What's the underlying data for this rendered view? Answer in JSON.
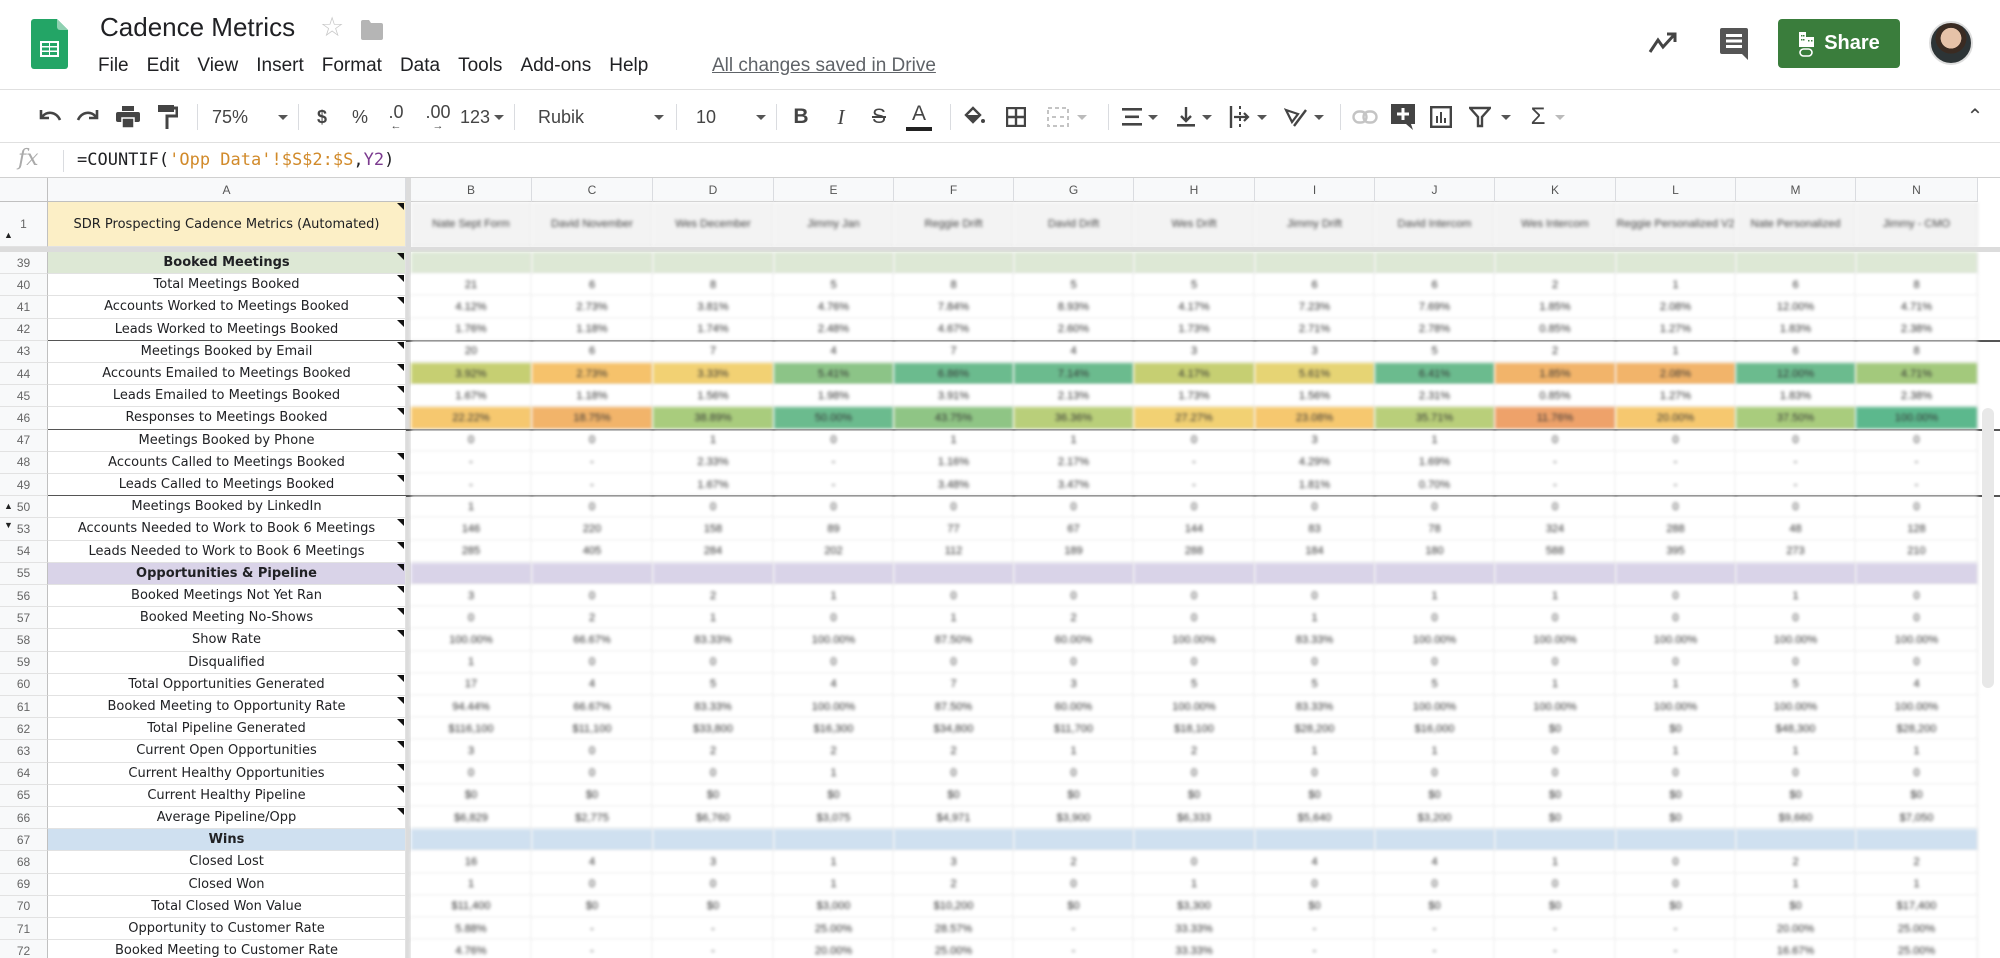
{
  "app": {
    "doc_title": "Cadence Metrics",
    "menu": [
      "File",
      "Edit",
      "View",
      "Insert",
      "Format",
      "Data",
      "Tools",
      "Add-ons",
      "Help"
    ],
    "save_status": "All changes saved in Drive",
    "share_label": "Share",
    "colors": {
      "share_green": "#3a7d3c",
      "brand_green": "#23a566"
    }
  },
  "toolbar": {
    "zoom": "75%",
    "currency": "$",
    "percent": "%",
    "decrease_decimal": ".0",
    "increase_decimal": ".00",
    "more_formats": "123",
    "font": "Rubik",
    "font_size": "10",
    "bold": "B",
    "italic": "I",
    "strike": "S",
    "text_color": "A"
  },
  "formula_bar": {
    "fx": "fx",
    "formula_prefix": "=COUNTIF(",
    "formula_string": "'Opp Data'!$S$2:$S",
    "formula_comma": ",",
    "formula_ref": "Y2",
    "formula_suffix": ")"
  },
  "grid": {
    "column_letters": [
      "A",
      "B",
      "C",
      "D",
      "E",
      "F",
      "G",
      "H",
      "I",
      "J",
      "K",
      "L",
      "M",
      "N"
    ],
    "header_row": {
      "row_number": "1",
      "title": "SDR Prospecting Cadence Metrics (Automated)",
      "columns": [
        "Nate Sept Form",
        "David November",
        "Wes December",
        "Jimmy Jan",
        "Reggie Drift",
        "David Drift",
        "Wes Drift",
        "Jimmy Drift",
        "David Intercom",
        "Wes Intercom",
        "Reggie Personalized V2",
        "Nate Personalized",
        "Jimmy - CMO"
      ]
    },
    "rows": [
      {
        "n": "39",
        "label": "Booked Meetings",
        "type": "section",
        "bg": "#dde8d5",
        "values": []
      },
      {
        "n": "40",
        "label": "Total Meetings Booked",
        "values": [
          "21",
          "6",
          "8",
          "5",
          "8",
          "5",
          "5",
          "6",
          "6",
          "2",
          "1",
          "6",
          "8"
        ]
      },
      {
        "n": "41",
        "label": "Accounts Worked to Meetings Booked",
        "values": [
          "4.12%",
          "2.73%",
          "3.81%",
          "4.76%",
          "7.84%",
          "8.93%",
          "4.17%",
          "7.23%",
          "7.69%",
          "1.85%",
          "2.08%",
          "12.00%",
          "4.71%"
        ]
      },
      {
        "n": "42",
        "label": "Leads Worked to Meetings Booked",
        "values": [
          "1.76%",
          "1.18%",
          "1.74%",
          "2.48%",
          "4.67%",
          "2.60%",
          "1.73%",
          "2.71%",
          "2.78%",
          "0.85%",
          "1.27%",
          "1.83%",
          "2.38%"
        ]
      },
      {
        "n": "43",
        "label": "Meetings Booked by Email",
        "values": [
          "20",
          "6",
          "7",
          "4",
          "7",
          "4",
          "3",
          "3",
          "5",
          "2",
          "1",
          "6",
          "8"
        ]
      },
      {
        "n": "44",
        "label": "Accounts Emailed to Meetings Booked",
        "values": [
          "3.92%",
          "2.73%",
          "3.33%",
          "5.41%",
          "6.86%",
          "7.14%",
          "4.17%",
          "5.61%",
          "6.41%",
          "1.85%",
          "2.08%",
          "12.00%",
          "4.71%"
        ],
        "heat": [
          "#c6cf72",
          "#f6c26b",
          "#f2d173",
          "#8cc487",
          "#6bbb8e",
          "#6bbb8e",
          "#c6cf72",
          "#e6d474",
          "#6bbb8e",
          "#f2b46a",
          "#f2b46a",
          "#6bbb8e",
          "#a3c97c"
        ]
      },
      {
        "n": "45",
        "label": "Leads Emailed to Meetings Booked",
        "values": [
          "1.67%",
          "1.18%",
          "1.56%",
          "1.98%",
          "3.91%",
          "2.13%",
          "1.73%",
          "1.56%",
          "2.31%",
          "0.85%",
          "1.27%",
          "1.83%",
          "2.38%"
        ]
      },
      {
        "n": "46",
        "label": "Responses to Meetings Booked",
        "values": [
          "22.22%",
          "18.75%",
          "38.89%",
          "50.00%",
          "43.75%",
          "36.36%",
          "27.27%",
          "23.08%",
          "35.71%",
          "11.76%",
          "20.00%",
          "37.50%",
          "100.00%"
        ],
        "heat": [
          "#f6c86f",
          "#f2b46a",
          "#a9cc7d",
          "#6bbb8e",
          "#8fc585",
          "#b9cf7a",
          "#f2d173",
          "#f6c86f",
          "#b9cf7a",
          "#eea26a",
          "#f6c86f",
          "#a9cc7d",
          "#5cb88d"
        ]
      },
      {
        "n": "47",
        "label": "Meetings Booked by Phone",
        "values": [
          "0",
          "0",
          "1",
          "0",
          "1",
          "1",
          "0",
          "3",
          "1",
          "0",
          "0",
          "0",
          "0"
        ]
      },
      {
        "n": "48",
        "label": "Accounts Called to Meetings Booked",
        "values": [
          "-",
          "-",
          "2.33%",
          "-",
          "1.16%",
          "2.17%",
          "-",
          "4.29%",
          "1.69%",
          "-",
          "-",
          "-",
          "-"
        ]
      },
      {
        "n": "49",
        "label": "Leads Called to Meetings Booked",
        "values": [
          "-",
          "-",
          "1.67%",
          "-",
          "3.48%",
          "3.47%",
          "-",
          "1.81%",
          "0.70%",
          "-",
          "-",
          "-",
          "-"
        ]
      },
      {
        "n": "50",
        "label": "Meetings Booked by LinkedIn",
        "values": [
          "1",
          "0",
          "0",
          "0",
          "0",
          "0",
          "0",
          "0",
          "0",
          "0",
          "0",
          "0",
          "0"
        ]
      },
      {
        "n": "53",
        "label": "Accounts Needed to Work to Book 6 Meetings",
        "values": [
          "146",
          "220",
          "158",
          "89",
          "77",
          "67",
          "144",
          "83",
          "78",
          "324",
          "288",
          "48",
          "128"
        ]
      },
      {
        "n": "54",
        "label": "Leads Needed to Work to Book 6 Meetings",
        "values": [
          "285",
          "405",
          "284",
          "202",
          "112",
          "189",
          "288",
          "184",
          "180",
          "588",
          "395",
          "273",
          "210"
        ]
      },
      {
        "n": "55",
        "label": "Opportunities & Pipeline",
        "type": "section",
        "bg": "#d9d3e8",
        "values": []
      },
      {
        "n": "56",
        "label": "Booked Meetings Not Yet Ran",
        "values": [
          "3",
          "0",
          "2",
          "1",
          "0",
          "0",
          "0",
          "0",
          "1",
          "1",
          "0",
          "1",
          "0"
        ]
      },
      {
        "n": "57",
        "label": "Booked Meeting No-Shows",
        "values": [
          "0",
          "2",
          "1",
          "0",
          "1",
          "2",
          "0",
          "1",
          "0",
          "0",
          "0",
          "0",
          "0"
        ]
      },
      {
        "n": "58",
        "label": "Show Rate",
        "values": [
          "100.00%",
          "66.67%",
          "83.33%",
          "100.00%",
          "87.50%",
          "60.00%",
          "100.00%",
          "83.33%",
          "100.00%",
          "100.00%",
          "100.00%",
          "100.00%",
          "100.00%"
        ]
      },
      {
        "n": "59",
        "label": "Disqualified",
        "values": [
          "1",
          "0",
          "0",
          "0",
          "0",
          "0",
          "0",
          "0",
          "0",
          "0",
          "0",
          "0",
          "0"
        ]
      },
      {
        "n": "60",
        "label": "Total Opportunities Generated",
        "values": [
          "17",
          "4",
          "5",
          "4",
          "7",
          "3",
          "5",
          "5",
          "5",
          "1",
          "1",
          "5",
          "4"
        ]
      },
      {
        "n": "61",
        "label": "Booked Meeting to Opportunity Rate",
        "values": [
          "94.44%",
          "66.67%",
          "83.33%",
          "100.00%",
          "87.50%",
          "60.00%",
          "100.00%",
          "83.33%",
          "100.00%",
          "100.00%",
          "100.00%",
          "100.00%",
          "100.00%"
        ]
      },
      {
        "n": "62",
        "label": "Total Pipeline Generated",
        "values": [
          "$116,100",
          "$11,100",
          "$33,800",
          "$16,300",
          "$34,800",
          "$11,700",
          "$18,100",
          "$28,200",
          "$16,000",
          "$0",
          "$0",
          "$48,300",
          "$28,200"
        ]
      },
      {
        "n": "63",
        "label": "Current Open Opportunities",
        "values": [
          "3",
          "0",
          "2",
          "2",
          "2",
          "1",
          "2",
          "1",
          "1",
          "0",
          "1",
          "1",
          "1"
        ]
      },
      {
        "n": "64",
        "label": "Current Healthy Opportunities",
        "values": [
          "0",
          "0",
          "0",
          "1",
          "0",
          "0",
          "0",
          "0",
          "0",
          "0",
          "0",
          "0",
          "0"
        ]
      },
      {
        "n": "65",
        "label": "Current Healthy Pipeline",
        "values": [
          "$0",
          "$0",
          "$0",
          "$0",
          "$0",
          "$0",
          "$0",
          "$0",
          "$0",
          "$0",
          "$0",
          "$0",
          "$0"
        ]
      },
      {
        "n": "66",
        "label": "Average Pipeline/Opp",
        "values": [
          "$6,829",
          "$2,775",
          "$6,760",
          "$3,075",
          "$4,971",
          "$3,900",
          "$6,333",
          "$5,640",
          "$3,200",
          "$0",
          "$0",
          "$9,660",
          "$7,050"
        ]
      },
      {
        "n": "67",
        "label": "Wins",
        "type": "section",
        "bg": "#cfe0f0",
        "values": []
      },
      {
        "n": "68",
        "label": "Closed Lost",
        "values": [
          "16",
          "4",
          "3",
          "1",
          "3",
          "2",
          "0",
          "4",
          "4",
          "1",
          "0",
          "2",
          "2"
        ]
      },
      {
        "n": "69",
        "label": "Closed Won",
        "values": [
          "1",
          "0",
          "0",
          "1",
          "2",
          "0",
          "1",
          "0",
          "0",
          "0",
          "0",
          "1",
          "1"
        ]
      },
      {
        "n": "70",
        "label": "Total Closed Won Value",
        "values": [
          "$11,400",
          "$0",
          "$0",
          "$3,000",
          "$10,200",
          "$0",
          "$3,300",
          "$0",
          "$0",
          "$0",
          "$0",
          "$0",
          "$17,400"
        ]
      },
      {
        "n": "71",
        "label": "Opportunity to Customer Rate",
        "values": [
          "5.88%",
          "-",
          "-",
          "25.00%",
          "28.57%",
          "-",
          "33.33%",
          "-",
          "-",
          "-",
          "-",
          "20.00%",
          "25.00%"
        ]
      },
      {
        "n": "72",
        "label": "Booked Meeting to Customer Rate",
        "values": [
          "4.76%",
          "-",
          "-",
          "20.00%",
          "25.00%",
          "-",
          "33.33%",
          "-",
          "-",
          "-",
          "-",
          "16.67%",
          "25.00%"
        ]
      }
    ]
  }
}
